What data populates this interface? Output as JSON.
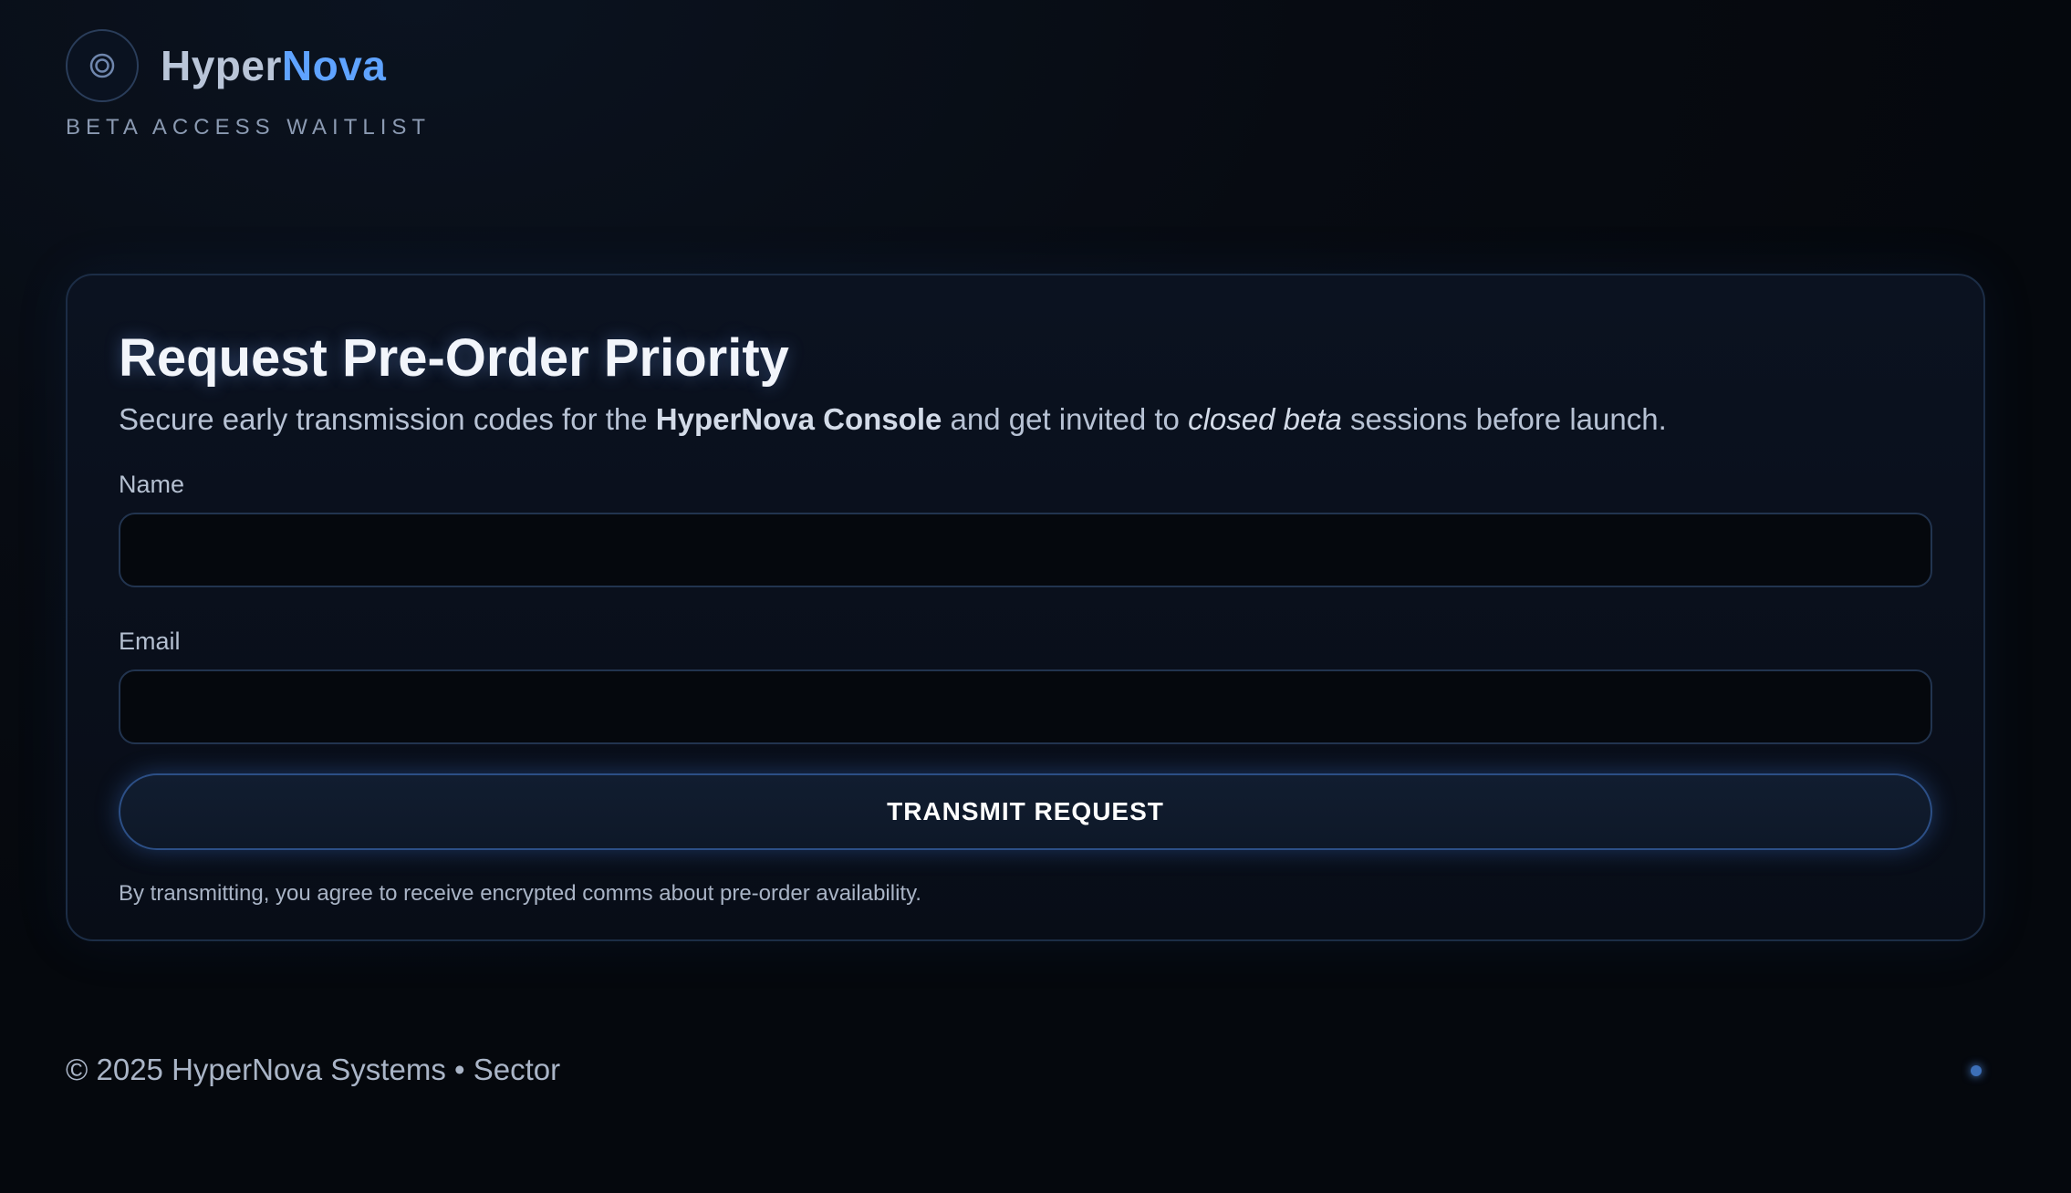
{
  "brand": {
    "name_part1": "Hyper",
    "name_part2": "Nova",
    "tagline": "BETA ACCESS WAITLIST",
    "logo_icon": "concentric-circles-icon"
  },
  "form": {
    "title": "Request Pre-Order Priority",
    "subtitle": {
      "text1": "Secure early transmission codes for the ",
      "bold": "HyperNova Console",
      "text2": " and get invited to ",
      "italic": "closed beta",
      "text3": " sessions before launch."
    },
    "name_label": "Name",
    "name_value": "",
    "email_label": "Email",
    "email_value": "",
    "submit_label": "TRANSMIT REQUEST",
    "disclaimer": "By transmitting, you agree to receive encrypted comms about pre-order availability."
  },
  "footer": {
    "copyright": "© 2025 HyperNova Systems • Sector"
  },
  "colors": {
    "accent": "#5fa3ff",
    "background": "#070b12",
    "card_border": "#1c2d46"
  }
}
